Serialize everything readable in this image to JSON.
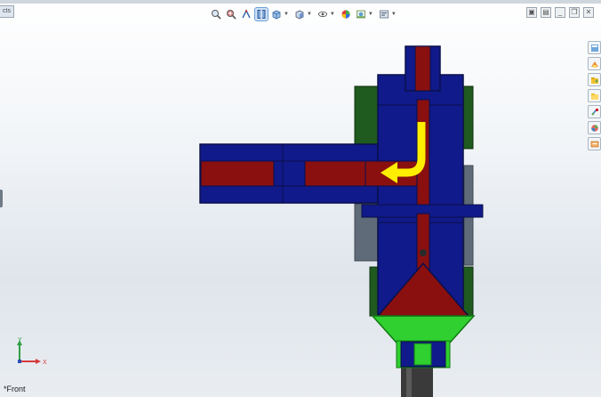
{
  "window": {
    "corner_tab_label": "cts",
    "view_label": "*Front"
  },
  "view_toolbar": {
    "tools": [
      {
        "icon": "zoom-to-fit-icon"
      },
      {
        "icon": "zoom-to-area-icon"
      },
      {
        "icon": "previous-view-icon"
      },
      {
        "icon": "section-view-icon",
        "active": true
      },
      {
        "icon": "view-orientation-icon",
        "dropdown": true
      },
      {
        "icon": "display-style-icon",
        "dropdown": true
      },
      {
        "icon": "hide-show-items-icon",
        "dropdown": true
      },
      {
        "icon": "edit-appearance-icon"
      },
      {
        "icon": "apply-scene-icon",
        "dropdown": true
      },
      {
        "icon": "view-settings-icon",
        "dropdown": true
      }
    ]
  },
  "window_controls": [
    {
      "icon": "tile-icon",
      "glyph": "▣"
    },
    {
      "icon": "split-icon",
      "glyph": "▤"
    },
    {
      "icon": "minimize-icon",
      "glyph": "_"
    },
    {
      "icon": "restore-icon",
      "glyph": "❐"
    },
    {
      "icon": "close-icon",
      "glyph": "✕"
    }
  ],
  "task_pane": {
    "icons": [
      "resources-icon",
      "design-library-icon",
      "file-explorer-icon",
      "view-palette-icon",
      "appearances-icon",
      "custom-properties-icon",
      "forum-icon"
    ]
  },
  "model": {
    "colors": {
      "body": "#101a8a",
      "channel": "#8a1010",
      "bracket": "#1f5a1f",
      "support": "#5f6b78",
      "nozzle": "#2fd02f",
      "stem": "#3a3a3a",
      "flow_arrow": "#ffee00"
    }
  },
  "triad": {
    "x_axis_label": "X",
    "y_axis_label": "Y"
  }
}
